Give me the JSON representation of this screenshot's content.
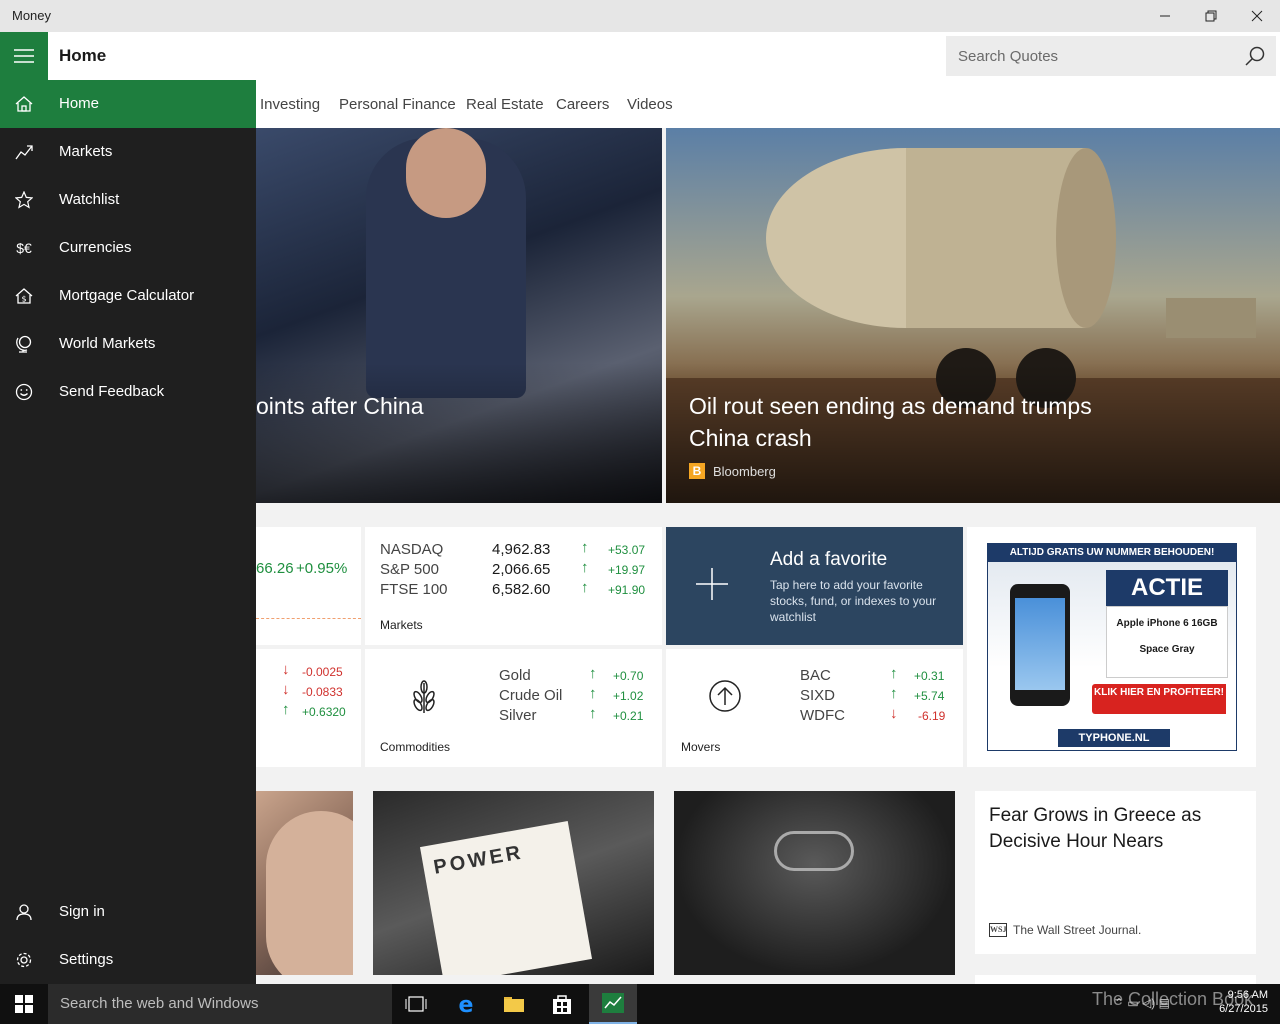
{
  "window": {
    "title": "Money"
  },
  "header": {
    "page_title": "Home",
    "search_placeholder": "Search Quotes"
  },
  "tabs": [
    "Investing",
    "Personal Finance",
    "Real Estate",
    "Careers",
    "Videos"
  ],
  "sidenav": {
    "items": [
      {
        "label": "Home",
        "icon": "home-icon",
        "active": true
      },
      {
        "label": "Markets",
        "icon": "chart-icon"
      },
      {
        "label": "Watchlist",
        "icon": "star-icon"
      },
      {
        "label": "Currencies",
        "icon": "currency-icon",
        "glyph": "$€"
      },
      {
        "label": "Mortgage Calculator",
        "icon": "house-dollar-icon"
      },
      {
        "label": "World Markets",
        "icon": "globe-icon"
      },
      {
        "label": "Send Feedback",
        "icon": "smiley-icon"
      }
    ],
    "bottom": [
      {
        "label": "Sign in",
        "icon": "person-icon"
      },
      {
        "label": "Settings",
        "icon": "gear-icon"
      }
    ]
  },
  "heroes": [
    {
      "headline": "oints after China",
      "source": ""
    },
    {
      "headline": "Oil rout seen ending as demand trumps China crash",
      "source": "Bloomberg",
      "source_logo": "B"
    }
  ],
  "partial_quote": {
    "value": "66.26",
    "change": "+0.95%"
  },
  "currencies_partial": [
    {
      "change": "-0.0025",
      "dir": "down"
    },
    {
      "change": "-0.0833",
      "dir": "down"
    },
    {
      "change": "+0.6320",
      "dir": "up"
    }
  ],
  "markets": {
    "label": "Markets",
    "rows": [
      {
        "name": "NASDAQ",
        "value": "4,962.83",
        "change": "+53.07",
        "dir": "up"
      },
      {
        "name": "S&P 500",
        "value": "2,066.65",
        "change": "+19.97",
        "dir": "up"
      },
      {
        "name": "FTSE 100",
        "value": "6,582.60",
        "change": "+91.90",
        "dir": "up"
      }
    ]
  },
  "favorite": {
    "title": "Add a favorite",
    "desc": "Tap here to add your favorite stocks, fund, or indexes to your watchlist"
  },
  "commodities": {
    "label": "Commodities",
    "rows": [
      {
        "name": "Gold",
        "change": "+0.70",
        "dir": "up"
      },
      {
        "name": "Crude Oil",
        "change": "+1.02",
        "dir": "up"
      },
      {
        "name": "Silver",
        "change": "+0.21",
        "dir": "up"
      }
    ]
  },
  "movers": {
    "label": "Movers",
    "rows": [
      {
        "name": "BAC",
        "change": "+0.31",
        "dir": "up"
      },
      {
        "name": "SIXD",
        "change": "+5.74",
        "dir": "up"
      },
      {
        "name": "WDFC",
        "change": "-6.19",
        "dir": "down"
      }
    ]
  },
  "ad": {
    "top": "ALTIJD GRATIS UW NUMMER BEHOUDEN!",
    "headline": "ACTIE",
    "product": "Apple iPhone 6 16GB",
    "color": "Space Gray",
    "cta": "KLIK HIER EN PROFITEER!",
    "brand": "TYPHONE.NL"
  },
  "news": [
    {
      "type": "image"
    },
    {
      "type": "image",
      "text": "POWER"
    },
    {
      "type": "image"
    },
    {
      "headline": "Fear Grows in Greece as Decisive Hour Nears",
      "source": "The Wall Street Journal.",
      "source_logo": "WSJ"
    }
  ],
  "taskbar": {
    "search_placeholder": "Search the web and Windows",
    "time": "9:56 AM",
    "date": "6/27/2015",
    "watermark": "The Collection Book"
  },
  "colors": {
    "accent": "#1e7e3e",
    "nav_bg": "#1f1f1f",
    "up": "#1f8f3f",
    "down": "#d0312d",
    "favorite_bg": "#2c4560"
  }
}
